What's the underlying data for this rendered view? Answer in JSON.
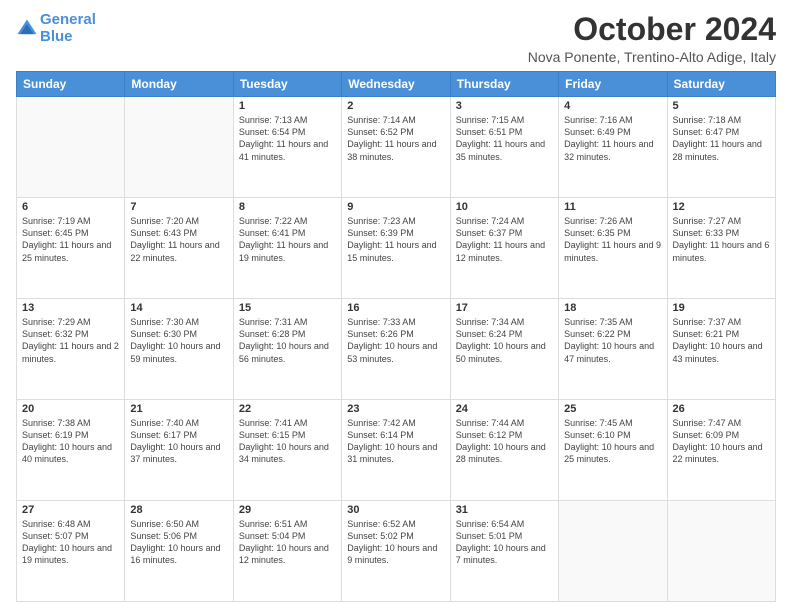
{
  "header": {
    "logo_line1": "General",
    "logo_line2": "Blue",
    "month_title": "October 2024",
    "location": "Nova Ponente, Trentino-Alto Adige, Italy"
  },
  "days_of_week": [
    "Sunday",
    "Monday",
    "Tuesday",
    "Wednesday",
    "Thursday",
    "Friday",
    "Saturday"
  ],
  "weeks": [
    [
      {
        "day": "",
        "sunrise": "",
        "sunset": "",
        "daylight": ""
      },
      {
        "day": "",
        "sunrise": "",
        "sunset": "",
        "daylight": ""
      },
      {
        "day": "1",
        "sunrise": "Sunrise: 7:13 AM",
        "sunset": "Sunset: 6:54 PM",
        "daylight": "Daylight: 11 hours and 41 minutes."
      },
      {
        "day": "2",
        "sunrise": "Sunrise: 7:14 AM",
        "sunset": "Sunset: 6:52 PM",
        "daylight": "Daylight: 11 hours and 38 minutes."
      },
      {
        "day": "3",
        "sunrise": "Sunrise: 7:15 AM",
        "sunset": "Sunset: 6:51 PM",
        "daylight": "Daylight: 11 hours and 35 minutes."
      },
      {
        "day": "4",
        "sunrise": "Sunrise: 7:16 AM",
        "sunset": "Sunset: 6:49 PM",
        "daylight": "Daylight: 11 hours and 32 minutes."
      },
      {
        "day": "5",
        "sunrise": "Sunrise: 7:18 AM",
        "sunset": "Sunset: 6:47 PM",
        "daylight": "Daylight: 11 hours and 28 minutes."
      }
    ],
    [
      {
        "day": "6",
        "sunrise": "Sunrise: 7:19 AM",
        "sunset": "Sunset: 6:45 PM",
        "daylight": "Daylight: 11 hours and 25 minutes."
      },
      {
        "day": "7",
        "sunrise": "Sunrise: 7:20 AM",
        "sunset": "Sunset: 6:43 PM",
        "daylight": "Daylight: 11 hours and 22 minutes."
      },
      {
        "day": "8",
        "sunrise": "Sunrise: 7:22 AM",
        "sunset": "Sunset: 6:41 PM",
        "daylight": "Daylight: 11 hours and 19 minutes."
      },
      {
        "day": "9",
        "sunrise": "Sunrise: 7:23 AM",
        "sunset": "Sunset: 6:39 PM",
        "daylight": "Daylight: 11 hours and 15 minutes."
      },
      {
        "day": "10",
        "sunrise": "Sunrise: 7:24 AM",
        "sunset": "Sunset: 6:37 PM",
        "daylight": "Daylight: 11 hours and 12 minutes."
      },
      {
        "day": "11",
        "sunrise": "Sunrise: 7:26 AM",
        "sunset": "Sunset: 6:35 PM",
        "daylight": "Daylight: 11 hours and 9 minutes."
      },
      {
        "day": "12",
        "sunrise": "Sunrise: 7:27 AM",
        "sunset": "Sunset: 6:33 PM",
        "daylight": "Daylight: 11 hours and 6 minutes."
      }
    ],
    [
      {
        "day": "13",
        "sunrise": "Sunrise: 7:29 AM",
        "sunset": "Sunset: 6:32 PM",
        "daylight": "Daylight: 11 hours and 2 minutes."
      },
      {
        "day": "14",
        "sunrise": "Sunrise: 7:30 AM",
        "sunset": "Sunset: 6:30 PM",
        "daylight": "Daylight: 10 hours and 59 minutes."
      },
      {
        "day": "15",
        "sunrise": "Sunrise: 7:31 AM",
        "sunset": "Sunset: 6:28 PM",
        "daylight": "Daylight: 10 hours and 56 minutes."
      },
      {
        "day": "16",
        "sunrise": "Sunrise: 7:33 AM",
        "sunset": "Sunset: 6:26 PM",
        "daylight": "Daylight: 10 hours and 53 minutes."
      },
      {
        "day": "17",
        "sunrise": "Sunrise: 7:34 AM",
        "sunset": "Sunset: 6:24 PM",
        "daylight": "Daylight: 10 hours and 50 minutes."
      },
      {
        "day": "18",
        "sunrise": "Sunrise: 7:35 AM",
        "sunset": "Sunset: 6:22 PM",
        "daylight": "Daylight: 10 hours and 47 minutes."
      },
      {
        "day": "19",
        "sunrise": "Sunrise: 7:37 AM",
        "sunset": "Sunset: 6:21 PM",
        "daylight": "Daylight: 10 hours and 43 minutes."
      }
    ],
    [
      {
        "day": "20",
        "sunrise": "Sunrise: 7:38 AM",
        "sunset": "Sunset: 6:19 PM",
        "daylight": "Daylight: 10 hours and 40 minutes."
      },
      {
        "day": "21",
        "sunrise": "Sunrise: 7:40 AM",
        "sunset": "Sunset: 6:17 PM",
        "daylight": "Daylight: 10 hours and 37 minutes."
      },
      {
        "day": "22",
        "sunrise": "Sunrise: 7:41 AM",
        "sunset": "Sunset: 6:15 PM",
        "daylight": "Daylight: 10 hours and 34 minutes."
      },
      {
        "day": "23",
        "sunrise": "Sunrise: 7:42 AM",
        "sunset": "Sunset: 6:14 PM",
        "daylight": "Daylight: 10 hours and 31 minutes."
      },
      {
        "day": "24",
        "sunrise": "Sunrise: 7:44 AM",
        "sunset": "Sunset: 6:12 PM",
        "daylight": "Daylight: 10 hours and 28 minutes."
      },
      {
        "day": "25",
        "sunrise": "Sunrise: 7:45 AM",
        "sunset": "Sunset: 6:10 PM",
        "daylight": "Daylight: 10 hours and 25 minutes."
      },
      {
        "day": "26",
        "sunrise": "Sunrise: 7:47 AM",
        "sunset": "Sunset: 6:09 PM",
        "daylight": "Daylight: 10 hours and 22 minutes."
      }
    ],
    [
      {
        "day": "27",
        "sunrise": "Sunrise: 6:48 AM",
        "sunset": "Sunset: 5:07 PM",
        "daylight": "Daylight: 10 hours and 19 minutes."
      },
      {
        "day": "28",
        "sunrise": "Sunrise: 6:50 AM",
        "sunset": "Sunset: 5:06 PM",
        "daylight": "Daylight: 10 hours and 16 minutes."
      },
      {
        "day": "29",
        "sunrise": "Sunrise: 6:51 AM",
        "sunset": "Sunset: 5:04 PM",
        "daylight": "Daylight: 10 hours and 12 minutes."
      },
      {
        "day": "30",
        "sunrise": "Sunrise: 6:52 AM",
        "sunset": "Sunset: 5:02 PM",
        "daylight": "Daylight: 10 hours and 9 minutes."
      },
      {
        "day": "31",
        "sunrise": "Sunrise: 6:54 AM",
        "sunset": "Sunset: 5:01 PM",
        "daylight": "Daylight: 10 hours and 7 minutes."
      },
      {
        "day": "",
        "sunrise": "",
        "sunset": "",
        "daylight": ""
      },
      {
        "day": "",
        "sunrise": "",
        "sunset": "",
        "daylight": ""
      }
    ]
  ]
}
